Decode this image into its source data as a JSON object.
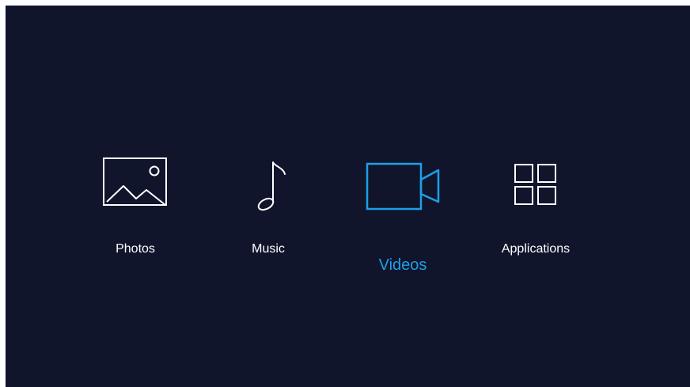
{
  "colors": {
    "background": "#10152c",
    "icon_default": "#ffffff",
    "accent_selected": "#1e9fe6"
  },
  "menu": {
    "selected": "videos",
    "items": [
      {
        "id": "photos",
        "label": "Photos",
        "icon": "photo-icon",
        "selected": false
      },
      {
        "id": "music",
        "label": "Music",
        "icon": "music-note-icon",
        "selected": false
      },
      {
        "id": "videos",
        "label": "Videos",
        "icon": "video-camera-icon",
        "selected": true
      },
      {
        "id": "applications",
        "label": "Applications",
        "icon": "apps-grid-icon",
        "selected": false
      }
    ]
  }
}
